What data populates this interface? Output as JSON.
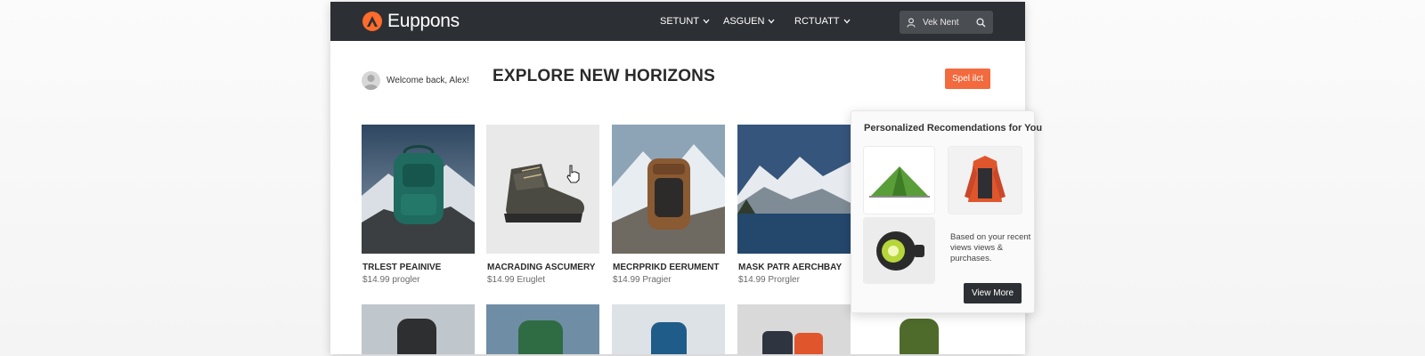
{
  "header": {
    "brand": "Euppons",
    "nav": [
      {
        "label": "SETUNT"
      },
      {
        "label": "ASGUEN"
      },
      {
        "label": "RCTUATT"
      }
    ],
    "search_label": "Vek Nent"
  },
  "main": {
    "welcome": "Welcome back, Alex!",
    "title": "EXPLORE NEW HORIZONS",
    "cta_label": "Spel ilct"
  },
  "products": [
    {
      "name": "TRLEST PEAINIVE",
      "price": "$14.99 progler",
      "icon": "backpack-teal"
    },
    {
      "name": "MACRADING ASCUMERY",
      "price": "$14.99 Eruglet",
      "icon": "hiking-boot"
    },
    {
      "name": "MECRPRIKD EERUMENT",
      "price": "$14.99 Pragier",
      "icon": "backpack-brown"
    },
    {
      "name": "MASK PATR AERCHBAY",
      "price": "$14.99 Prorgler",
      "icon": "mountain-lake"
    }
  ],
  "more_products": [
    {
      "icon": "backpack-dark"
    },
    {
      "icon": "backpack-green"
    },
    {
      "icon": "backpack-blue"
    },
    {
      "icon": "luggage-orange"
    },
    {
      "icon": "backpack-olive"
    }
  ],
  "recommendations": {
    "title": "Personalized Recomendations for You",
    "items": [
      {
        "icon": "tent-icon"
      },
      {
        "icon": "jacket-icon"
      },
      {
        "icon": "headlamp-icon"
      }
    ],
    "note": "Based on your recent views views & purchases.",
    "button_label": "View More"
  },
  "colors": {
    "topbar": "#2c2f33",
    "accent": "#f26a3d",
    "brand_logo": "#ff6b2c"
  }
}
